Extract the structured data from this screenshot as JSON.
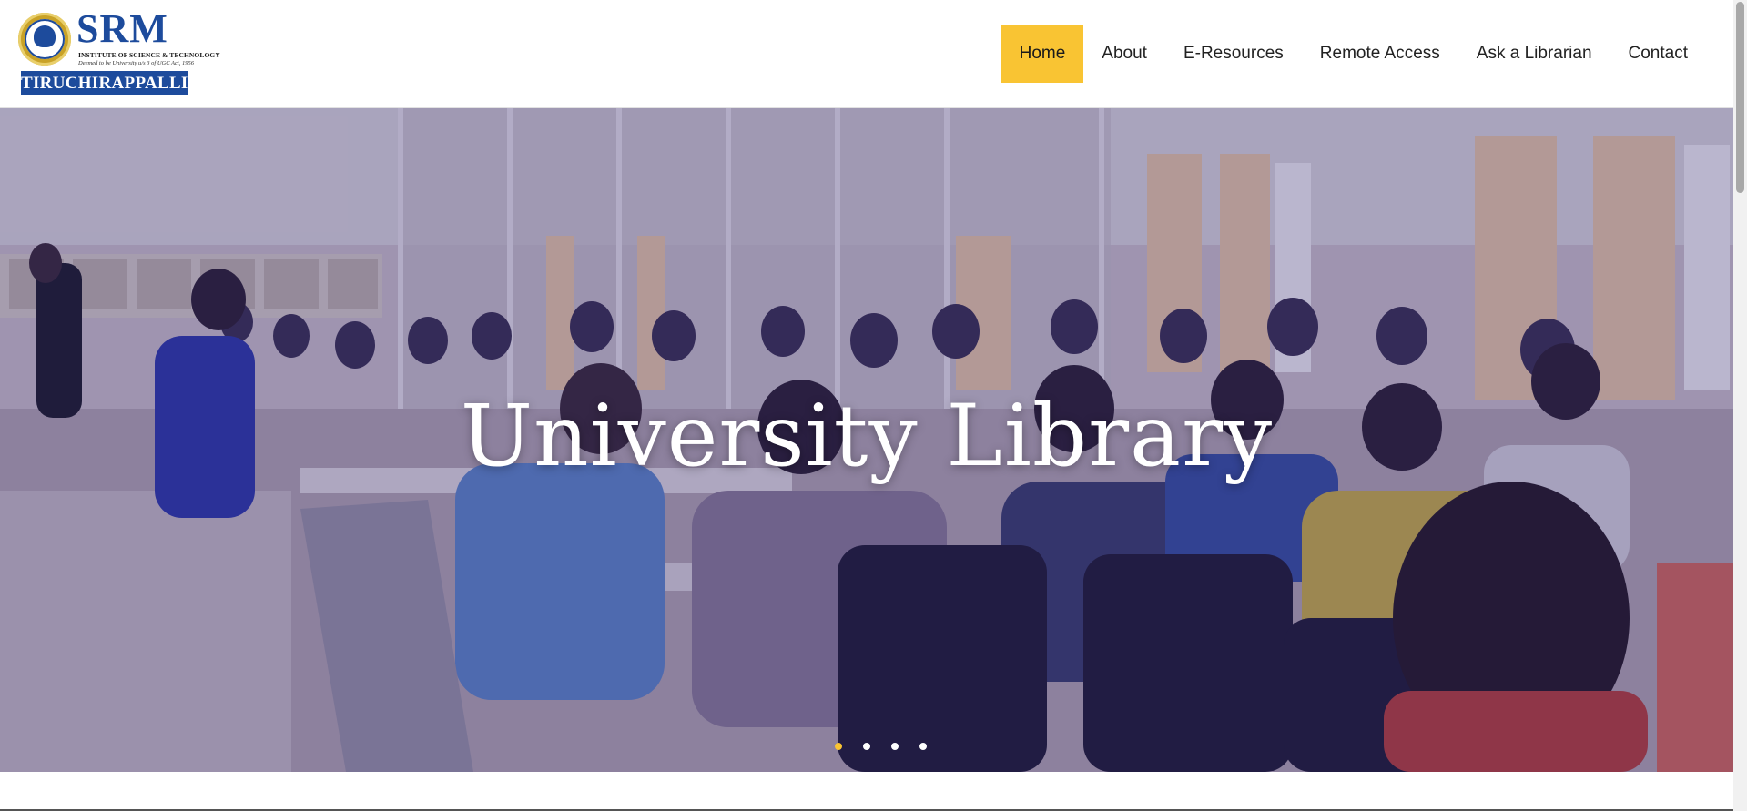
{
  "brand": {
    "name": "SRM",
    "tagline": "INSTITUTE OF SCIENCE & TECHNOLOGY",
    "subtagline": "Deemed to be University u/s 3 of UGC Act, 1956",
    "campus": "TIRUCHIRAPPALLI"
  },
  "nav": {
    "items": [
      {
        "label": "Home",
        "active": true
      },
      {
        "label": "About"
      },
      {
        "label": "E-Resources"
      },
      {
        "label": "Remote Access"
      },
      {
        "label": "Ask a Librarian"
      },
      {
        "label": "Contact"
      }
    ]
  },
  "hero": {
    "title": "University Library",
    "slides_total": 4,
    "active_slide": 1
  },
  "colors": {
    "accent": "#f9c433",
    "brand_blue": "#1d4b9c",
    "overlay": "rgba(40,30,110,0.28)"
  },
  "icons": [
    "university-seal-icon"
  ]
}
